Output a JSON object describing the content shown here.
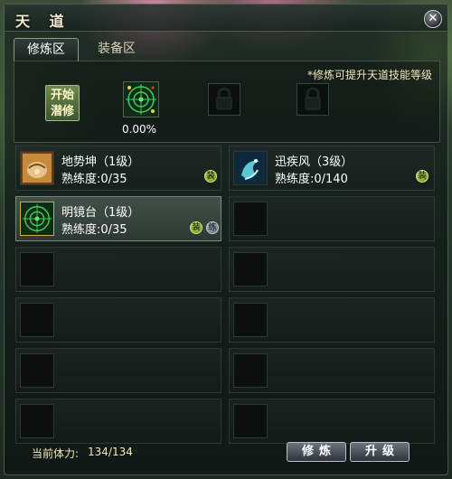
{
  "window": {
    "title": "天 道",
    "close_label": "✕"
  },
  "tabs": [
    {
      "label": "修炼区",
      "active": true
    },
    {
      "label": "装备区",
      "active": false
    }
  ],
  "cultivation": {
    "tip": "*修炼可提升天道技能等级",
    "start_button": {
      "line1": "开始",
      "line2": "潜修"
    },
    "progress_text": "0.00%",
    "progress_value": 0.0
  },
  "skills": [
    {
      "name": "地势坤（1级）",
      "prof": "熟练度:0/35",
      "badges": [
        "装"
      ],
      "icon": "earth-fist-icon"
    },
    {
      "name": "迅疾风（3级）",
      "prof": "熟练度:0/140",
      "badges": [
        "装"
      ],
      "icon": "wind-swirl-icon"
    },
    {
      "name": "明镜台（1级）",
      "prof": "熟练度:0/35",
      "badges": [
        "装",
        "练"
      ],
      "icon": "mirror-target-icon",
      "selected": true
    }
  ],
  "footer": {
    "stamina_label": "当前体力:",
    "stamina_value": "134/134",
    "cultivate_button": "修炼",
    "upgrade_button": "升级"
  },
  "colors": {
    "accent_text": "#f4e6b8",
    "equip_badge": "#78a828",
    "cultivate_badge": "#6c7a88"
  }
}
